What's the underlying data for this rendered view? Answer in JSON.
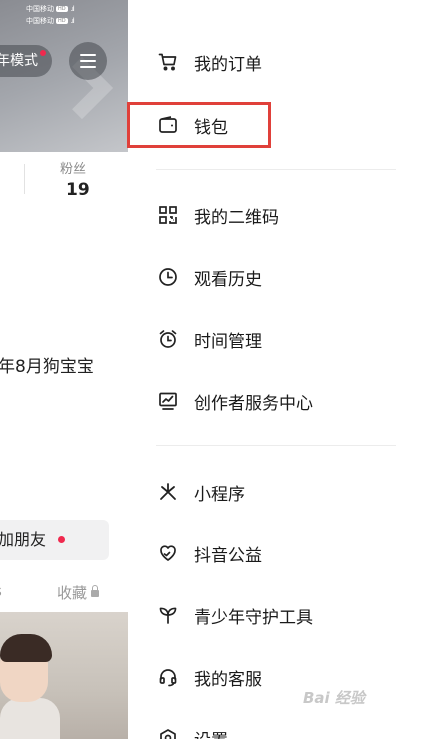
{
  "status_bar": {
    "carrier1": "中国移动",
    "carrier2": "中国移动",
    "hd": "HD"
  },
  "background": {
    "mode_label": "年模式",
    "fans_label": "粉丝",
    "fans_count": "19",
    "bio": "年8月狗宝宝",
    "add_friend": "加朋友",
    "tab_left": "s",
    "tab_favorites": "收藏"
  },
  "drawer": {
    "items": [
      {
        "label": "我的订单",
        "icon": "cart-icon"
      },
      {
        "label": "钱包",
        "icon": "wallet-icon"
      },
      {
        "label": "我的二维码",
        "icon": "qr-code-icon"
      },
      {
        "label": "观看历史",
        "icon": "clock-icon"
      },
      {
        "label": "时间管理",
        "icon": "alarm-icon"
      },
      {
        "label": "创作者服务中心",
        "icon": "creator-chart-icon"
      },
      {
        "label": "小程序",
        "icon": "mini-program-icon"
      },
      {
        "label": "抖音公益",
        "icon": "charity-heart-icon"
      },
      {
        "label": "青少年守护工具",
        "icon": "sprout-icon"
      },
      {
        "label": "我的客服",
        "icon": "headset-icon"
      },
      {
        "label": "设置",
        "icon": "settings-icon"
      }
    ]
  },
  "highlight_color": "#e0403a",
  "watermark": "Bai  经验"
}
